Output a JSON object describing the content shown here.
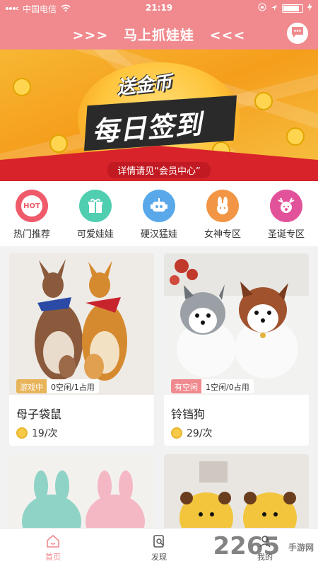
{
  "status": {
    "carrier": "中国电信",
    "time": "21:19",
    "battery_level": 0.85
  },
  "header": {
    "title": "马上抓娃娃",
    "arrows_left": ">>>",
    "arrows_right": "<<<"
  },
  "banner": {
    "line1": "送金币",
    "line2": "每日签到",
    "caption": "详情请见“会员中心”"
  },
  "categories": [
    {
      "label": "热门推荐",
      "icon": "hot-icon",
      "icon_text": "HOT",
      "color": "#ef5b6a"
    },
    {
      "label": "可爱娃娃",
      "icon": "gift-icon",
      "color": "#4fcfb0"
    },
    {
      "label": "硬汉猛娃",
      "icon": "robot-icon",
      "color": "#59a9ea"
    },
    {
      "label": "女神专区",
      "icon": "rabbit-icon",
      "color": "#f29645"
    },
    {
      "label": "圣诞专区",
      "icon": "reindeer-icon",
      "color": "#e2529a"
    }
  ],
  "products": [
    {
      "name": "母子袋鼠",
      "status": "游戏中",
      "occupancy": "0空闲/1占用",
      "price": "19/次"
    },
    {
      "name": "铃铛狗",
      "status": "有空闲",
      "occupancy": "1空闲/0占用",
      "price": "29/次"
    }
  ],
  "tabs": [
    {
      "label": "首页",
      "icon": "home-icon",
      "active": true
    },
    {
      "label": "发现",
      "icon": "discover-icon",
      "active": false
    },
    {
      "label": "我的",
      "icon": "profile-icon",
      "active": false
    }
  ],
  "watermark": {
    "text": "2265",
    "sub": "手游网"
  },
  "colors": {
    "accent": "#f08a8e"
  }
}
